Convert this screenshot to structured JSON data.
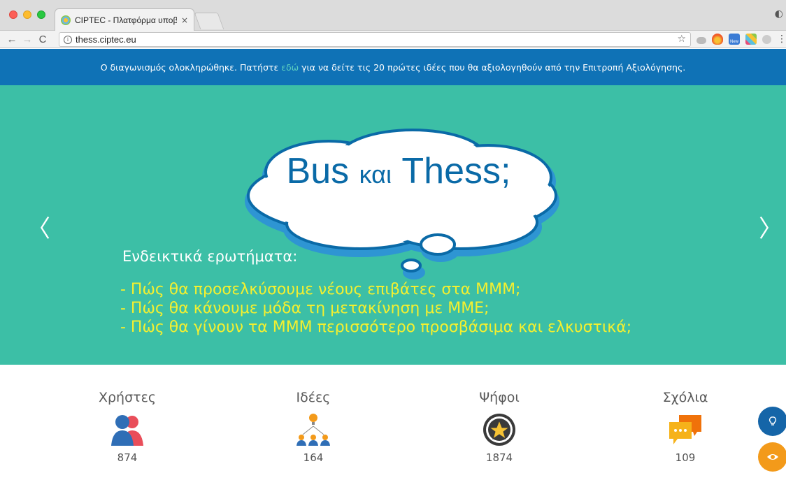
{
  "browser": {
    "tab_title": "CIPTEC - Πλατφόρμα υποβολής",
    "tab_close": "×",
    "url": "thess.ciptec.eu",
    "ext_new_label": "New"
  },
  "notice": {
    "before": "Ο διαγωνισμός ολοκληρώθηκε. Πατήστε ",
    "link": "εδώ",
    "after": " για να δείτε τις 20 πρώτες ιδέες που θα αξιολογηθούν από την Επιτροπή Αξιολόγησης."
  },
  "hero": {
    "title_part1": "Bus ",
    "title_part2": "και",
    "title_part3": " Thess;",
    "heading": "Ενδεικτικά ερωτήματα:",
    "questions": [
      "- Πώς θα προσελκύσουμε νέους επιβάτες στα ΜΜΜ;",
      "- Πώς θα κάνουμε μόδα τη μετακίνηση με ΜΜΕ;",
      "- Πώς θα γίνουν τα ΜΜΜ περισσότερο προσβάσιμα και ελκυστικά;"
    ],
    "prev_arrow": "〈",
    "next_arrow": "〉"
  },
  "stats": [
    {
      "label": "Χρήστες",
      "value": "874",
      "icon": "users-icon"
    },
    {
      "label": "Ιδέες",
      "value": "164",
      "icon": "ideas-icon"
    },
    {
      "label": "Ψήφοι",
      "value": "1874",
      "icon": "star-badge-icon"
    },
    {
      "label": "Σχόλια",
      "value": "109",
      "icon": "comments-icon"
    }
  ],
  "colors": {
    "notice_bg": "#0f72b6",
    "hero_bg": "#3cbfa6",
    "question_text": "#f4f02f",
    "title_text": "#0a6aa7"
  }
}
